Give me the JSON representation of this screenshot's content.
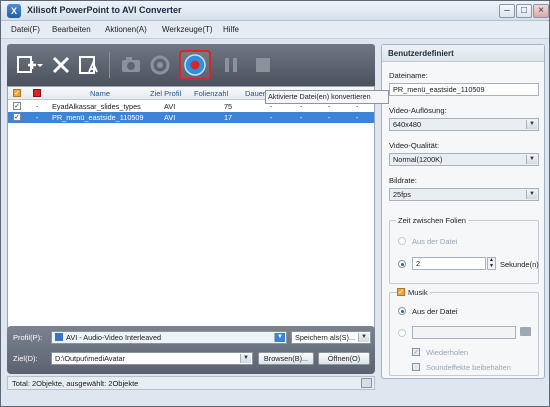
{
  "app": {
    "title": "Xilisoft PowerPoint to AVI Converter",
    "icon_letter": "X"
  },
  "window_controls": {
    "minimize": "–",
    "maximize": "□",
    "close": "×"
  },
  "menu": [
    "Datei(F)",
    "Bearbeiten",
    "Aktionen(A)",
    "Werkzeuge(T)",
    "Hilfe"
  ],
  "toolbar": {
    "buttons": [
      "add-file-icon",
      "dropdown-arrow-icon",
      "delete-icon",
      "clear-icon",
      "snapshot-icon",
      "settings-icon",
      "convert-icon",
      "pause-icon",
      "stop-icon"
    ],
    "tooltip": "Aktivierte Datei(en) konvertieren",
    "accent": "#d8262a"
  },
  "grid": {
    "columns": [
      "Name",
      "Ziel Profil",
      "Folienzahl",
      "Dauer"
    ],
    "rows": [
      {
        "checked": "✓",
        "status": "-",
        "name": "EyadAlkassar_slides_types",
        "profile": "AVI",
        "slides": "75",
        "duration": "-",
        "c5": "-",
        "c6": "-",
        "c7": "-"
      },
      {
        "checked": "✓",
        "status": "-",
        "name": "PR_menü_eastside_110509",
        "profile": "AVI",
        "slides": "17",
        "duration": "-",
        "c5": "-",
        "c6": "-",
        "c7": "-"
      }
    ]
  },
  "output": {
    "profile_label": "Profil(P):",
    "profile_value": "AVI - Audio-Video Interleaved",
    "save_as_label": "Speichern als(S)...",
    "target_label": "Ziel(D):",
    "target_value": "D:\\Output\\mediAvatar",
    "browse_label": "Browsen(B)...",
    "open_label": "Öffnen(O)"
  },
  "status": {
    "text": "Total: 2Objekte, ausgewählt: 2Objekte"
  },
  "settings": {
    "title": "Benutzerdefiniert",
    "filename_label": "Dateiname:",
    "filename_value": "PR_menü_eastside_110509",
    "resolution_label": "Video-Auflösung:",
    "resolution_value": "640x480",
    "quality_label": "Video-Qualität:",
    "quality_value": "Normal(1200K)",
    "framerate_label": "Bildrate:",
    "framerate_value": "25fps",
    "timing_group": "Zeit zwischen Folien",
    "timing_from_file": "Aus der Datei",
    "timing_seconds_value": "2",
    "timing_seconds_unit": "Sekunde(n)",
    "music_group": "Musik",
    "music_from_file": "Aus der Datei",
    "music_repeat": "Wiederholen",
    "music_keep_sfx": "Soundeffekte beibehalten"
  }
}
